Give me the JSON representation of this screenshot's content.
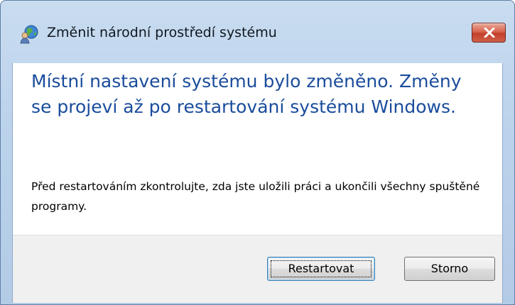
{
  "window": {
    "title": "Změnit národní prostředí systému",
    "icon": "globe-with-user-icon",
    "close_icon": "close-icon"
  },
  "message": {
    "main_instruction": "Místní nastavení systému bylo změněno. Změny se projeví až po restartování systému Windows.",
    "body": "Před restartováním zkontrolujte, zda jste uložili práci a ukončili všechny spuštěné programy."
  },
  "buttons": {
    "restart_label": "Restartovat",
    "cancel_label": "Storno"
  },
  "colors": {
    "instruction_text": "#1a4c9c",
    "close_button": "#c2402a"
  }
}
